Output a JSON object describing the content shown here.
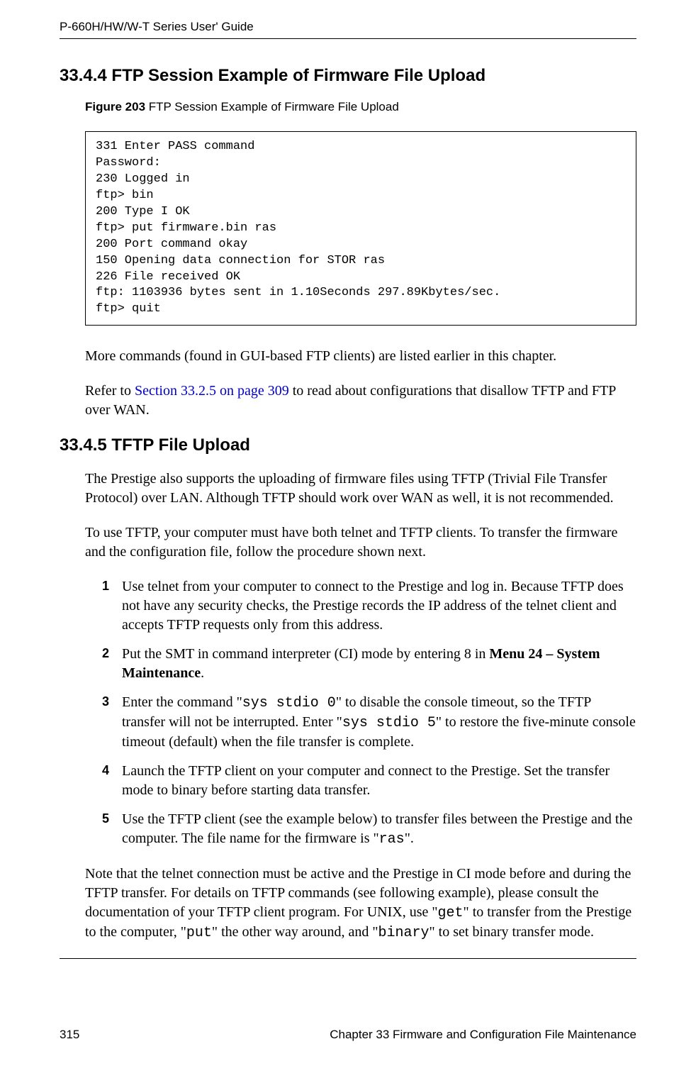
{
  "header": {
    "guide_title": "P-660H/HW/W-T Series User' Guide"
  },
  "section1": {
    "number": "33.4.4  ",
    "title": "FTP Session Example of Firmware File Upload"
  },
  "figure": {
    "label": "Figure 203   ",
    "caption": "FTP Session Example of Firmware File Upload",
    "code": "331 Enter PASS command\nPassword:\n230 Logged in\nftp> bin\n200 Type I OK\nftp> put firmware.bin ras\n200 Port command okay\n150 Opening data connection for STOR ras\n226 File received OK\nftp: 1103936 bytes sent in 1.10Seconds 297.89Kbytes/sec.\nftp> quit"
  },
  "para1": "More commands (found in GUI-based FTP clients) are listed earlier in this chapter.",
  "para2_pre": "Refer to ",
  "para2_link": "Section 33.2.5 on page 309",
  "para2_post": " to read about configurations that disallow TFTP and FTP over WAN.",
  "section2": {
    "number": "33.4.5  ",
    "title": "TFTP File Upload"
  },
  "para3": "The Prestige also supports the uploading of firmware files using TFTP (Trivial File Transfer Protocol) over LAN. Although TFTP should work over WAN as well, it is not recommended.",
  "para4": "To use TFTP, your computer must have both telnet and TFTP clients. To transfer the firmware and the configuration file, follow the procedure shown next.",
  "steps": {
    "s1": "Use telnet from your computer to connect to the Prestige and log in. Because TFTP does not have any security checks, the Prestige records the IP address of the telnet client and accepts TFTP requests only from this address.",
    "s2_pre": "Put the SMT in command interpreter (CI) mode by entering 8 in ",
    "s2_bold": "Menu 24 – System Maintenance",
    "s2_post": ".",
    "s3_a": "Enter the command \"",
    "s3_code1": "sys stdio 0",
    "s3_b": "\" to disable the console timeout, so the TFTP transfer will not be interrupted. Enter \"",
    "s3_code2": "sys stdio 5",
    "s3_c": "\" to restore the five-minute console timeout (default) when the file transfer is complete.",
    "s4": "Launch the TFTP client on your computer and connect to the Prestige. Set the transfer mode to binary before starting data transfer.",
    "s5_a": "Use the TFTP client (see the example below) to transfer files between the Prestige and the computer. The file name for the firmware is \"",
    "s5_code": "ras",
    "s5_b": "\"."
  },
  "para5_a": "Note that the telnet connection must be active and the Prestige in CI mode before and during the TFTP transfer. For details on TFTP commands (see following example), please consult the documentation of your TFTP client program. For UNIX, use \"",
  "para5_code1": "get",
  "para5_b": "\" to transfer from the Prestige to the computer, \"",
  "para5_code2": "put",
  "para5_c": "\" the other way around, and \"",
  "para5_code3": "binary",
  "para5_d": "\" to set binary transfer mode.",
  "footer": {
    "page": "315",
    "chapter": "Chapter 33 Firmware and Configuration File Maintenance"
  }
}
